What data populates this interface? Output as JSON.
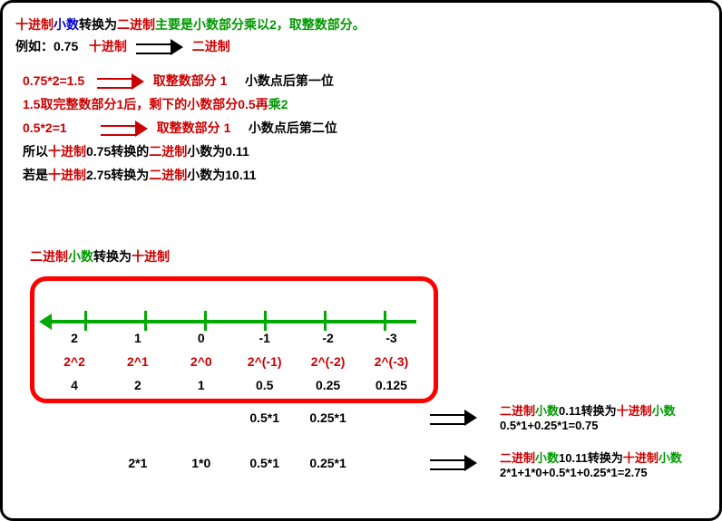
{
  "intro": {
    "p1a": "十进制",
    "p1b": "小数",
    "p1c": "转换为",
    "p1d": "二进制",
    "p1e": "主要是小数部分乘以2，取整数部分。",
    "p2a": "例如：0.75",
    "p2b": "十进制",
    "p2c": "二进制"
  },
  "steps": {
    "s1a": "0.75*2=1.5",
    "s1b": "取整数部分 1",
    "s1c": "小数点后第一位",
    "s2": "1.5取完整数部分1后，剩下的小数部分0.5再",
    "s2b": "乘2",
    "s3a": "0.5*2=1",
    "s3b": "取整数部分 1",
    "s3c": "小数点后第二位",
    "s4a": "所以",
    "s4b": "十进制",
    "s4c": "0.75转换的",
    "s4d": "二进制",
    "s4e": "小数为0.11",
    "s5a": "若是",
    "s5b": "十进制",
    "s5c": "2.75转换为",
    "s5d": "二进制",
    "s5e": "小数为10.11"
  },
  "sec2": {
    "t1": "二进制",
    "t2": "小数",
    "t3": "转换为",
    "t4": "十进制"
  },
  "row_idx": [
    "2",
    "1",
    "0",
    "-1",
    "-2",
    "-3"
  ],
  "row_pow": [
    "2^2",
    "2^1",
    "2^0",
    "2^(-1)",
    "2^(-2)",
    "2^(-3)"
  ],
  "row_val": [
    "4",
    "2",
    "1",
    "0.5",
    "0.25",
    "0.125"
  ],
  "row_e1": [
    "",
    "",
    "",
    "0.5*1",
    "0.25*1",
    ""
  ],
  "row_e2": [
    "",
    "2*1",
    "1*0",
    "0.5*1",
    "0.25*1",
    ""
  ],
  "side1": {
    "a": "二进制",
    "b": "小数",
    "c": "0.11转换为",
    "d": "十进制",
    "e": "小数",
    "f": "0.5*1+0.25*1=0.75"
  },
  "side2": {
    "a": "二进制",
    "b": "小数",
    "c": "10.11转换为",
    "d": "十进制",
    "e": "小数",
    "f": "2*1+1*0+0.5*1+0.25*1=2.75"
  }
}
